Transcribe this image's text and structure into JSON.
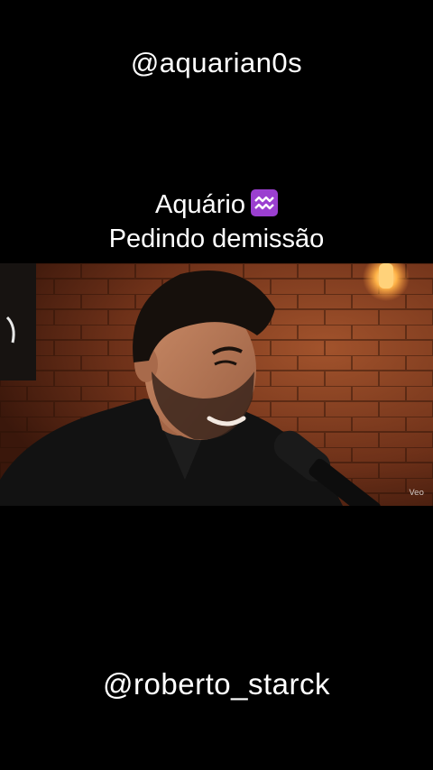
{
  "top_handle": "@aquarian0s",
  "caption": {
    "line1": "Aquário",
    "zodiac_icon": "aquarius-symbol-icon",
    "line2": "Pedindo demissão"
  },
  "video": {
    "watermark": "Veo"
  },
  "bottom_handle": "@roberto_starck",
  "colors": {
    "background": "#000000",
    "text": "#ffffff",
    "zodiac_badge": "#9b3fd0"
  }
}
